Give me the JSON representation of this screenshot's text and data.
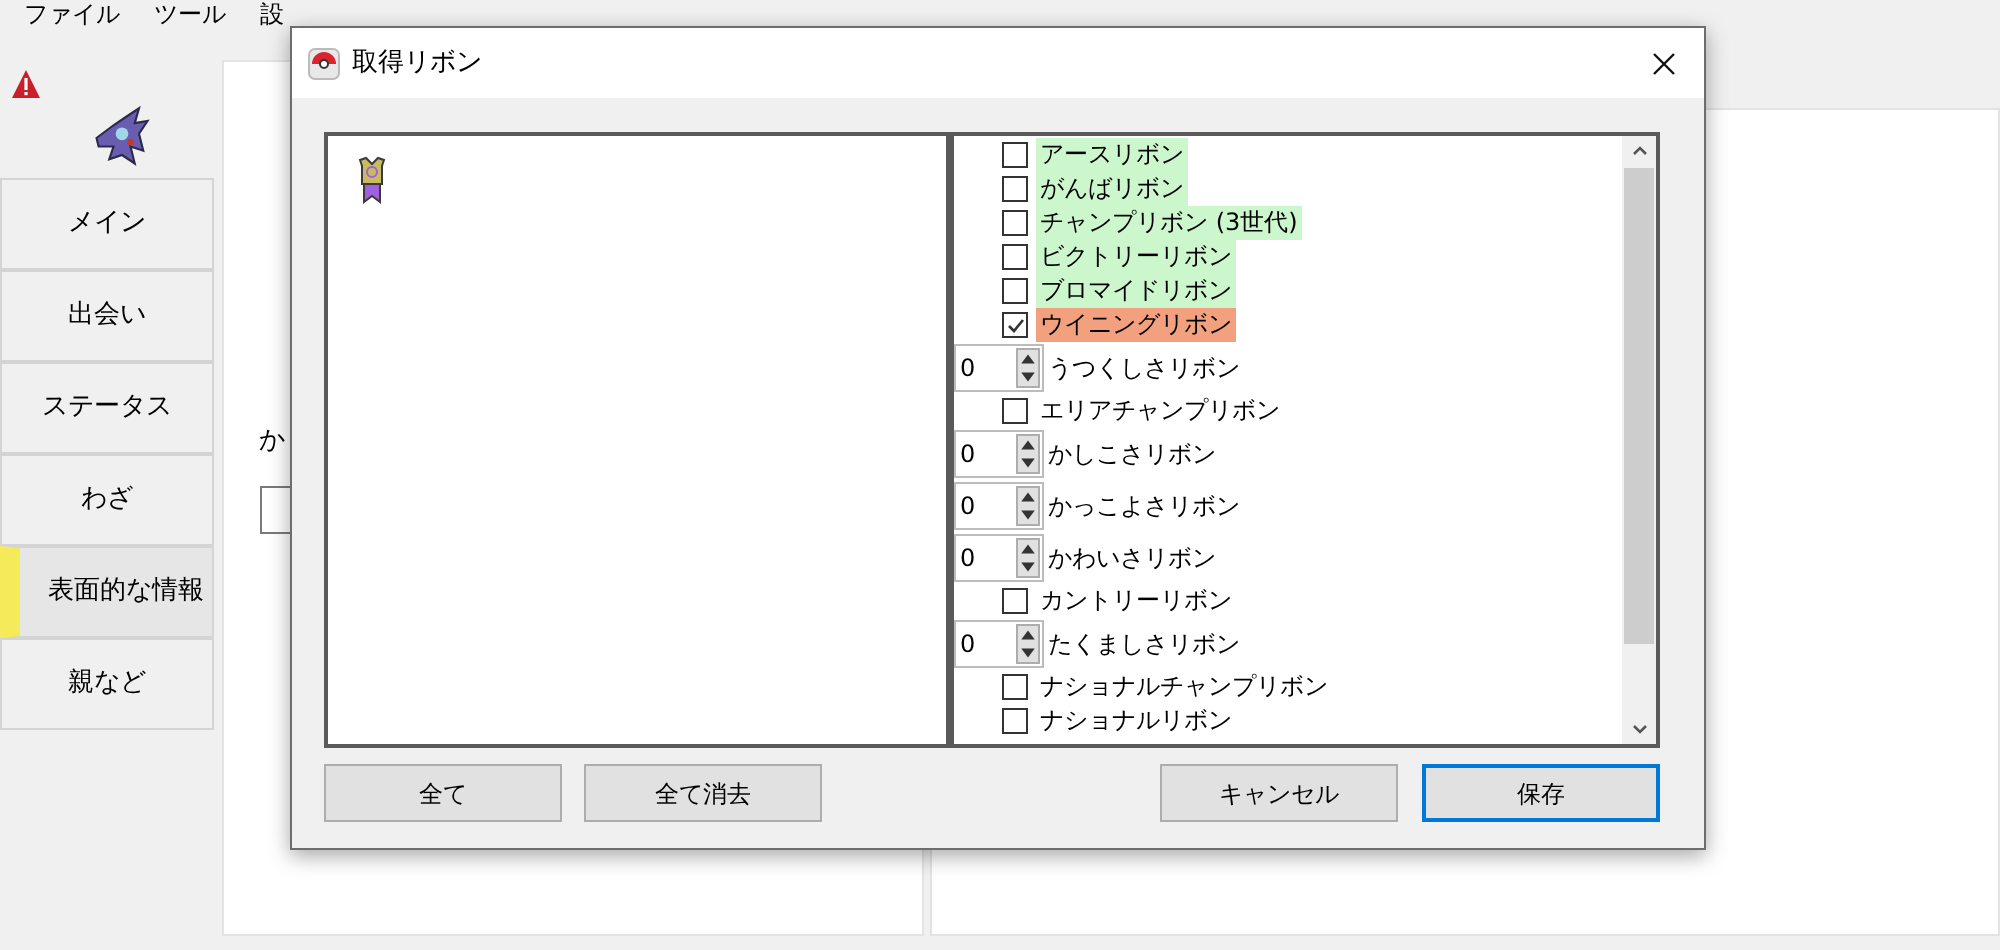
{
  "menu": [
    "ファイル",
    "ツール",
    "設"
  ],
  "sidebar": {
    "items": [
      {
        "label": "メイン",
        "selected": false
      },
      {
        "label": "出会い",
        "selected": false
      },
      {
        "label": "ステータス",
        "selected": false
      },
      {
        "label": "わざ",
        "selected": false
      },
      {
        "label": "表面的な情報",
        "selected": true
      },
      {
        "label": "親など",
        "selected": false
      }
    ]
  },
  "background_label": "か",
  "dialog": {
    "title": "取得リボン",
    "ribbons": [
      {
        "kind": "checkbox",
        "label": "アースリボン",
        "checked": false,
        "color": "#ccf7cc"
      },
      {
        "kind": "checkbox",
        "label": "がんばリボン",
        "checked": false,
        "color": "#ccf7cc"
      },
      {
        "kind": "checkbox",
        "label": "チャンプリボン (3世代)",
        "checked": false,
        "color": "#ccf7cc"
      },
      {
        "kind": "checkbox",
        "label": "ビクトリーリボン",
        "checked": false,
        "color": "#ccf7cc"
      },
      {
        "kind": "checkbox",
        "label": "ブロマイドリボン",
        "checked": false,
        "color": "#ccf7cc"
      },
      {
        "kind": "checkbox",
        "label": "ウイニングリボン",
        "checked": true,
        "color": "#f2a07e"
      },
      {
        "kind": "counter",
        "label": "うつくしさリボン",
        "value": "0"
      },
      {
        "kind": "checkbox",
        "label": "エリアチャンプリボン",
        "checked": false
      },
      {
        "kind": "counter",
        "label": "かしこさリボン",
        "value": "0"
      },
      {
        "kind": "counter",
        "label": "かっこよさリボン",
        "value": "0"
      },
      {
        "kind": "counter",
        "label": "かわいさリボン",
        "value": "0"
      },
      {
        "kind": "checkbox",
        "label": "カントリーリボン",
        "checked": false
      },
      {
        "kind": "counter",
        "label": "たくましさリボン",
        "value": "0"
      },
      {
        "kind": "checkbox",
        "label": "ナショナルチャンプリボン",
        "checked": false
      },
      {
        "kind": "checkbox",
        "label": "ナショナルリボン",
        "checked": false
      }
    ],
    "left_buttons": [
      "全て",
      "全て消去"
    ],
    "right_buttons": [
      {
        "label": "キャンセル",
        "default": false
      },
      {
        "label": "保存",
        "default": true
      }
    ]
  }
}
